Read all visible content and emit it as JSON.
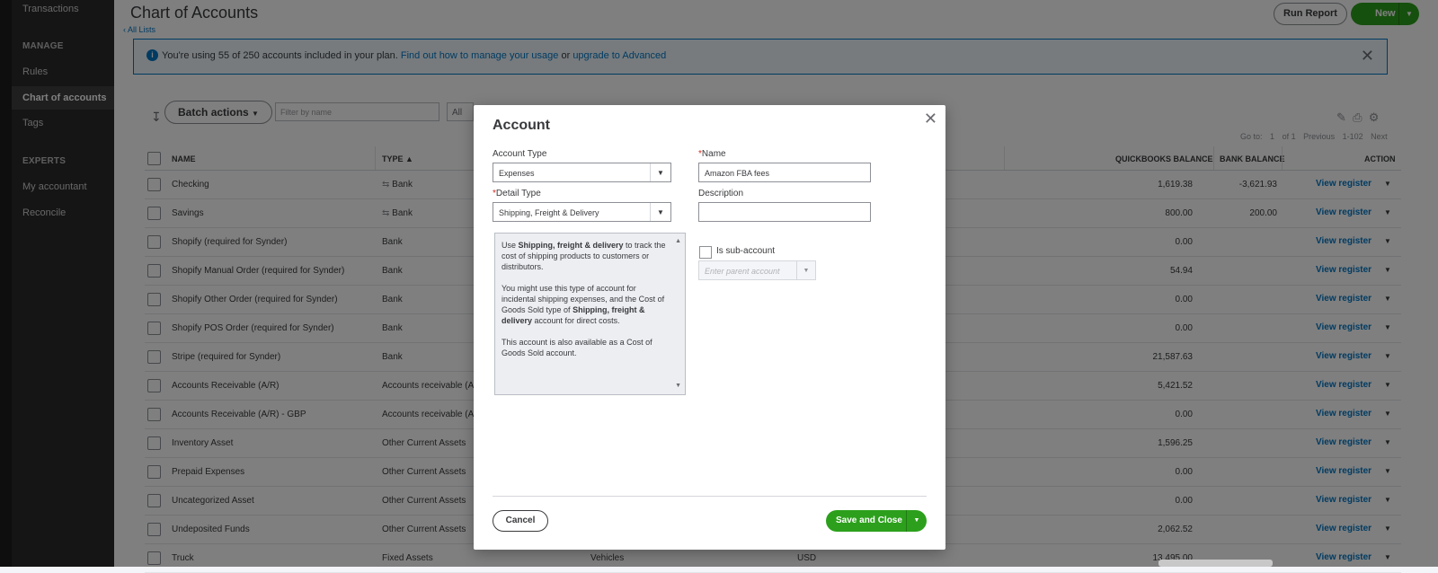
{
  "sidebar": {
    "transactions": "Transactions",
    "manage_header": "MANAGE",
    "rules": "Rules",
    "chart_of_accounts": "Chart of accounts",
    "tags": "Tags",
    "experts_header": "EXPERTS",
    "my_accountant": "My accountant",
    "reconcile": "Reconcile"
  },
  "header": {
    "title": "Chart of Accounts",
    "all_lists": "All Lists",
    "run_report": "Run Report",
    "new": "New"
  },
  "banner": {
    "text": "You're using 55 of 250 accounts included in your plan.",
    "link1": "Find out how to manage your usage",
    "or": "or",
    "link2": "upgrade to Advanced"
  },
  "toolbar": {
    "batch_actions": "Batch actions",
    "filter_placeholder": "Filter by name",
    "filter_all": "All",
    "goto_label": "Go to:",
    "goto_page": "1",
    "of_pages": "of 1",
    "previous": "Previous",
    "range": "1-102",
    "next": "Next"
  },
  "table": {
    "headers": {
      "name": "NAME",
      "type": "TYPE",
      "qb_balance": "QUICKBOOKS BALANCE",
      "bank_balance": "BANK BALANCE",
      "action": "ACTION"
    },
    "action_label": "View register",
    "rows": [
      {
        "name": "Checking",
        "type": "Bank",
        "bank_icon": true,
        "detail": "",
        "currency": "",
        "qb": "1,619.38",
        "bank": "-3,621.93"
      },
      {
        "name": "Savings",
        "type": "Bank",
        "bank_icon": true,
        "detail": "",
        "currency": "",
        "qb": "800.00",
        "bank": "200.00"
      },
      {
        "name": "Shopify (required for Synder)",
        "type": "Bank",
        "bank_icon": false,
        "detail": "",
        "currency": "",
        "qb": "0.00",
        "bank": ""
      },
      {
        "name": "Shopify Manual Order (required for Synder)",
        "type": "Bank",
        "bank_icon": false,
        "detail": "",
        "currency": "",
        "qb": "54.94",
        "bank": ""
      },
      {
        "name": "Shopify Other Order (required for Synder)",
        "type": "Bank",
        "bank_icon": false,
        "detail": "",
        "currency": "",
        "qb": "0.00",
        "bank": ""
      },
      {
        "name": "Shopify POS Order (required for Synder)",
        "type": "Bank",
        "bank_icon": false,
        "detail": "",
        "currency": "",
        "qb": "0.00",
        "bank": ""
      },
      {
        "name": "Stripe (required for Synder)",
        "type": "Bank",
        "bank_icon": false,
        "detail": "",
        "currency": "",
        "qb": "21,587.63",
        "bank": ""
      },
      {
        "name": "Accounts Receivable (A/R)",
        "type": "Accounts receivable (A/R)",
        "bank_icon": false,
        "detail": "",
        "currency": "",
        "qb": "5,421.52",
        "bank": ""
      },
      {
        "name": "Accounts Receivable (A/R) - GBP",
        "type": "Accounts receivable (A/R)",
        "bank_icon": false,
        "detail": "",
        "currency": "",
        "qb": "0.00",
        "bank": ""
      },
      {
        "name": "Inventory Asset",
        "type": "Other Current Assets",
        "bank_icon": false,
        "detail": "",
        "currency": "",
        "qb": "1,596.25",
        "bank": ""
      },
      {
        "name": "Prepaid Expenses",
        "type": "Other Current Assets",
        "bank_icon": false,
        "detail": "",
        "currency": "",
        "qb": "0.00",
        "bank": ""
      },
      {
        "name": "Uncategorized Asset",
        "type": "Other Current Assets",
        "bank_icon": false,
        "detail": "",
        "currency": "",
        "qb": "0.00",
        "bank": ""
      },
      {
        "name": "Undeposited Funds",
        "type": "Other Current Assets",
        "bank_icon": false,
        "detail": "",
        "currency": "",
        "qb": "2,062.52",
        "bank": ""
      },
      {
        "name": "Truck",
        "type": "Fixed Assets",
        "bank_icon": false,
        "detail": "Vehicles",
        "currency": "USD",
        "qb": "13,495.00",
        "bank": ""
      }
    ]
  },
  "modal": {
    "title": "Account",
    "account_type_label": "Account Type",
    "account_type_value": "Expenses",
    "name_label": "Name",
    "name_value": "Amazon FBA fees",
    "detail_type_label": "Detail Type",
    "detail_type_value": "Shipping, Freight & Delivery",
    "description_label": "Description",
    "description_value": "",
    "help_p1_pre": "Use ",
    "help_p1_bold": "Shipping, freight & delivery",
    "help_p1_post": " to track the cost of shipping products to customers or distributors.",
    "help_p2_pre": "You might use this type of account for incidental shipping expenses, and the Cost of Goods Sold type of ",
    "help_p2_bold": "Shipping, freight & delivery",
    "help_p2_post": " account for direct costs.",
    "help_p3": "This account is also available as a Cost of Goods Sold account.",
    "sub_account_label": "Is sub-account",
    "parent_placeholder": "Enter parent account",
    "cancel": "Cancel",
    "save_and_close": "Save and Close"
  },
  "colors": {
    "accent_green": "#2ca01c",
    "link_blue": "#0077c5",
    "sidebar_bg": "#2b2b2b"
  }
}
